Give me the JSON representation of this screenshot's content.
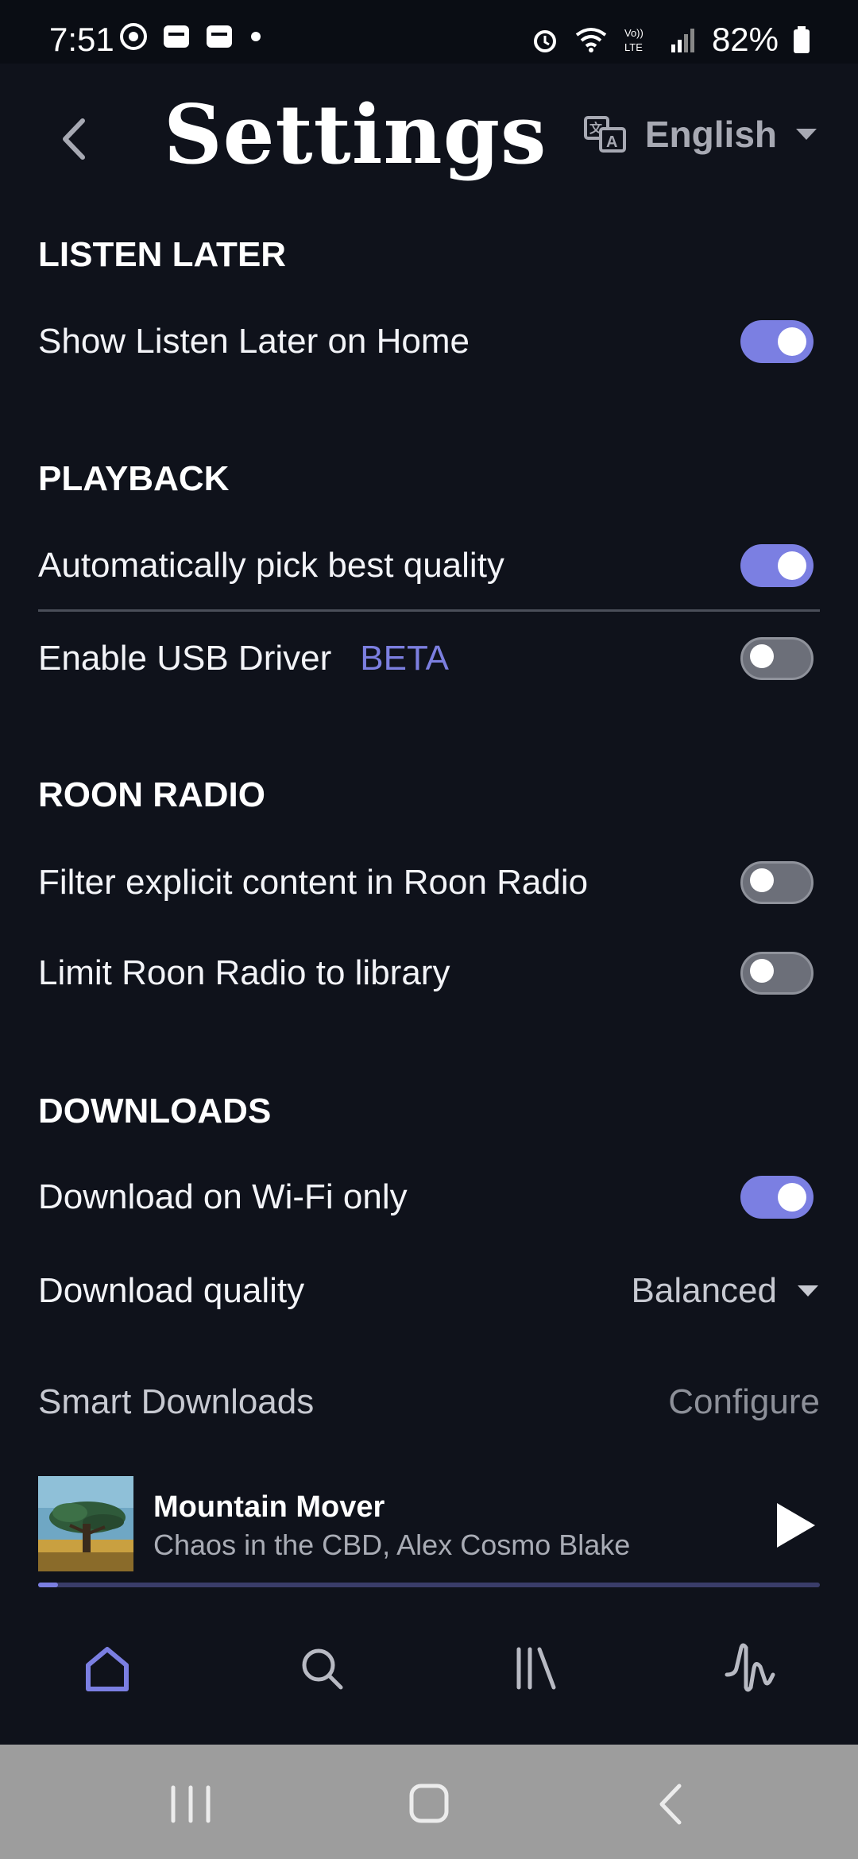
{
  "status_bar": {
    "time": "7:51",
    "battery": "82%",
    "left_icons": [
      "chrome-icon",
      "message-icon",
      "message-icon",
      "dot-icon"
    ],
    "right_icons": [
      "alarm-icon",
      "wifi-icon",
      "volte-icon",
      "signal-icon",
      "battery-icon"
    ]
  },
  "header": {
    "title": "Settings",
    "language": "English"
  },
  "sections": {
    "listen_later": {
      "title": "LISTEN LATER",
      "show_on_home": {
        "label": "Show Listen Later on Home",
        "on": true
      }
    },
    "playback": {
      "title": "PLAYBACK",
      "auto_quality": {
        "label": "Automatically pick best quality",
        "on": true
      },
      "usb_driver": {
        "label": "Enable USB Driver",
        "badge": "BETA",
        "on": false
      }
    },
    "roon_radio": {
      "title": "ROON RADIO",
      "filter_explicit": {
        "label": "Filter explicit content in Roon Radio",
        "on": false
      },
      "limit_library": {
        "label": "Limit Roon Radio to library",
        "on": false
      }
    },
    "downloads": {
      "title": "DOWNLOADS",
      "wifi_only": {
        "label": "Download on Wi-Fi only",
        "on": true
      },
      "quality": {
        "label": "Download quality",
        "value": "Balanced"
      },
      "smart": {
        "label": "Smart Downloads",
        "action": "Configure"
      }
    }
  },
  "now_playing": {
    "title": "Mountain Mover",
    "artist": "Chaos in the CBD, Alex Cosmo Blake",
    "progress": 0.02
  },
  "colors": {
    "accent": "#7b7fe2",
    "background": "#0f121b",
    "system_nav": "#9d9d9d"
  }
}
